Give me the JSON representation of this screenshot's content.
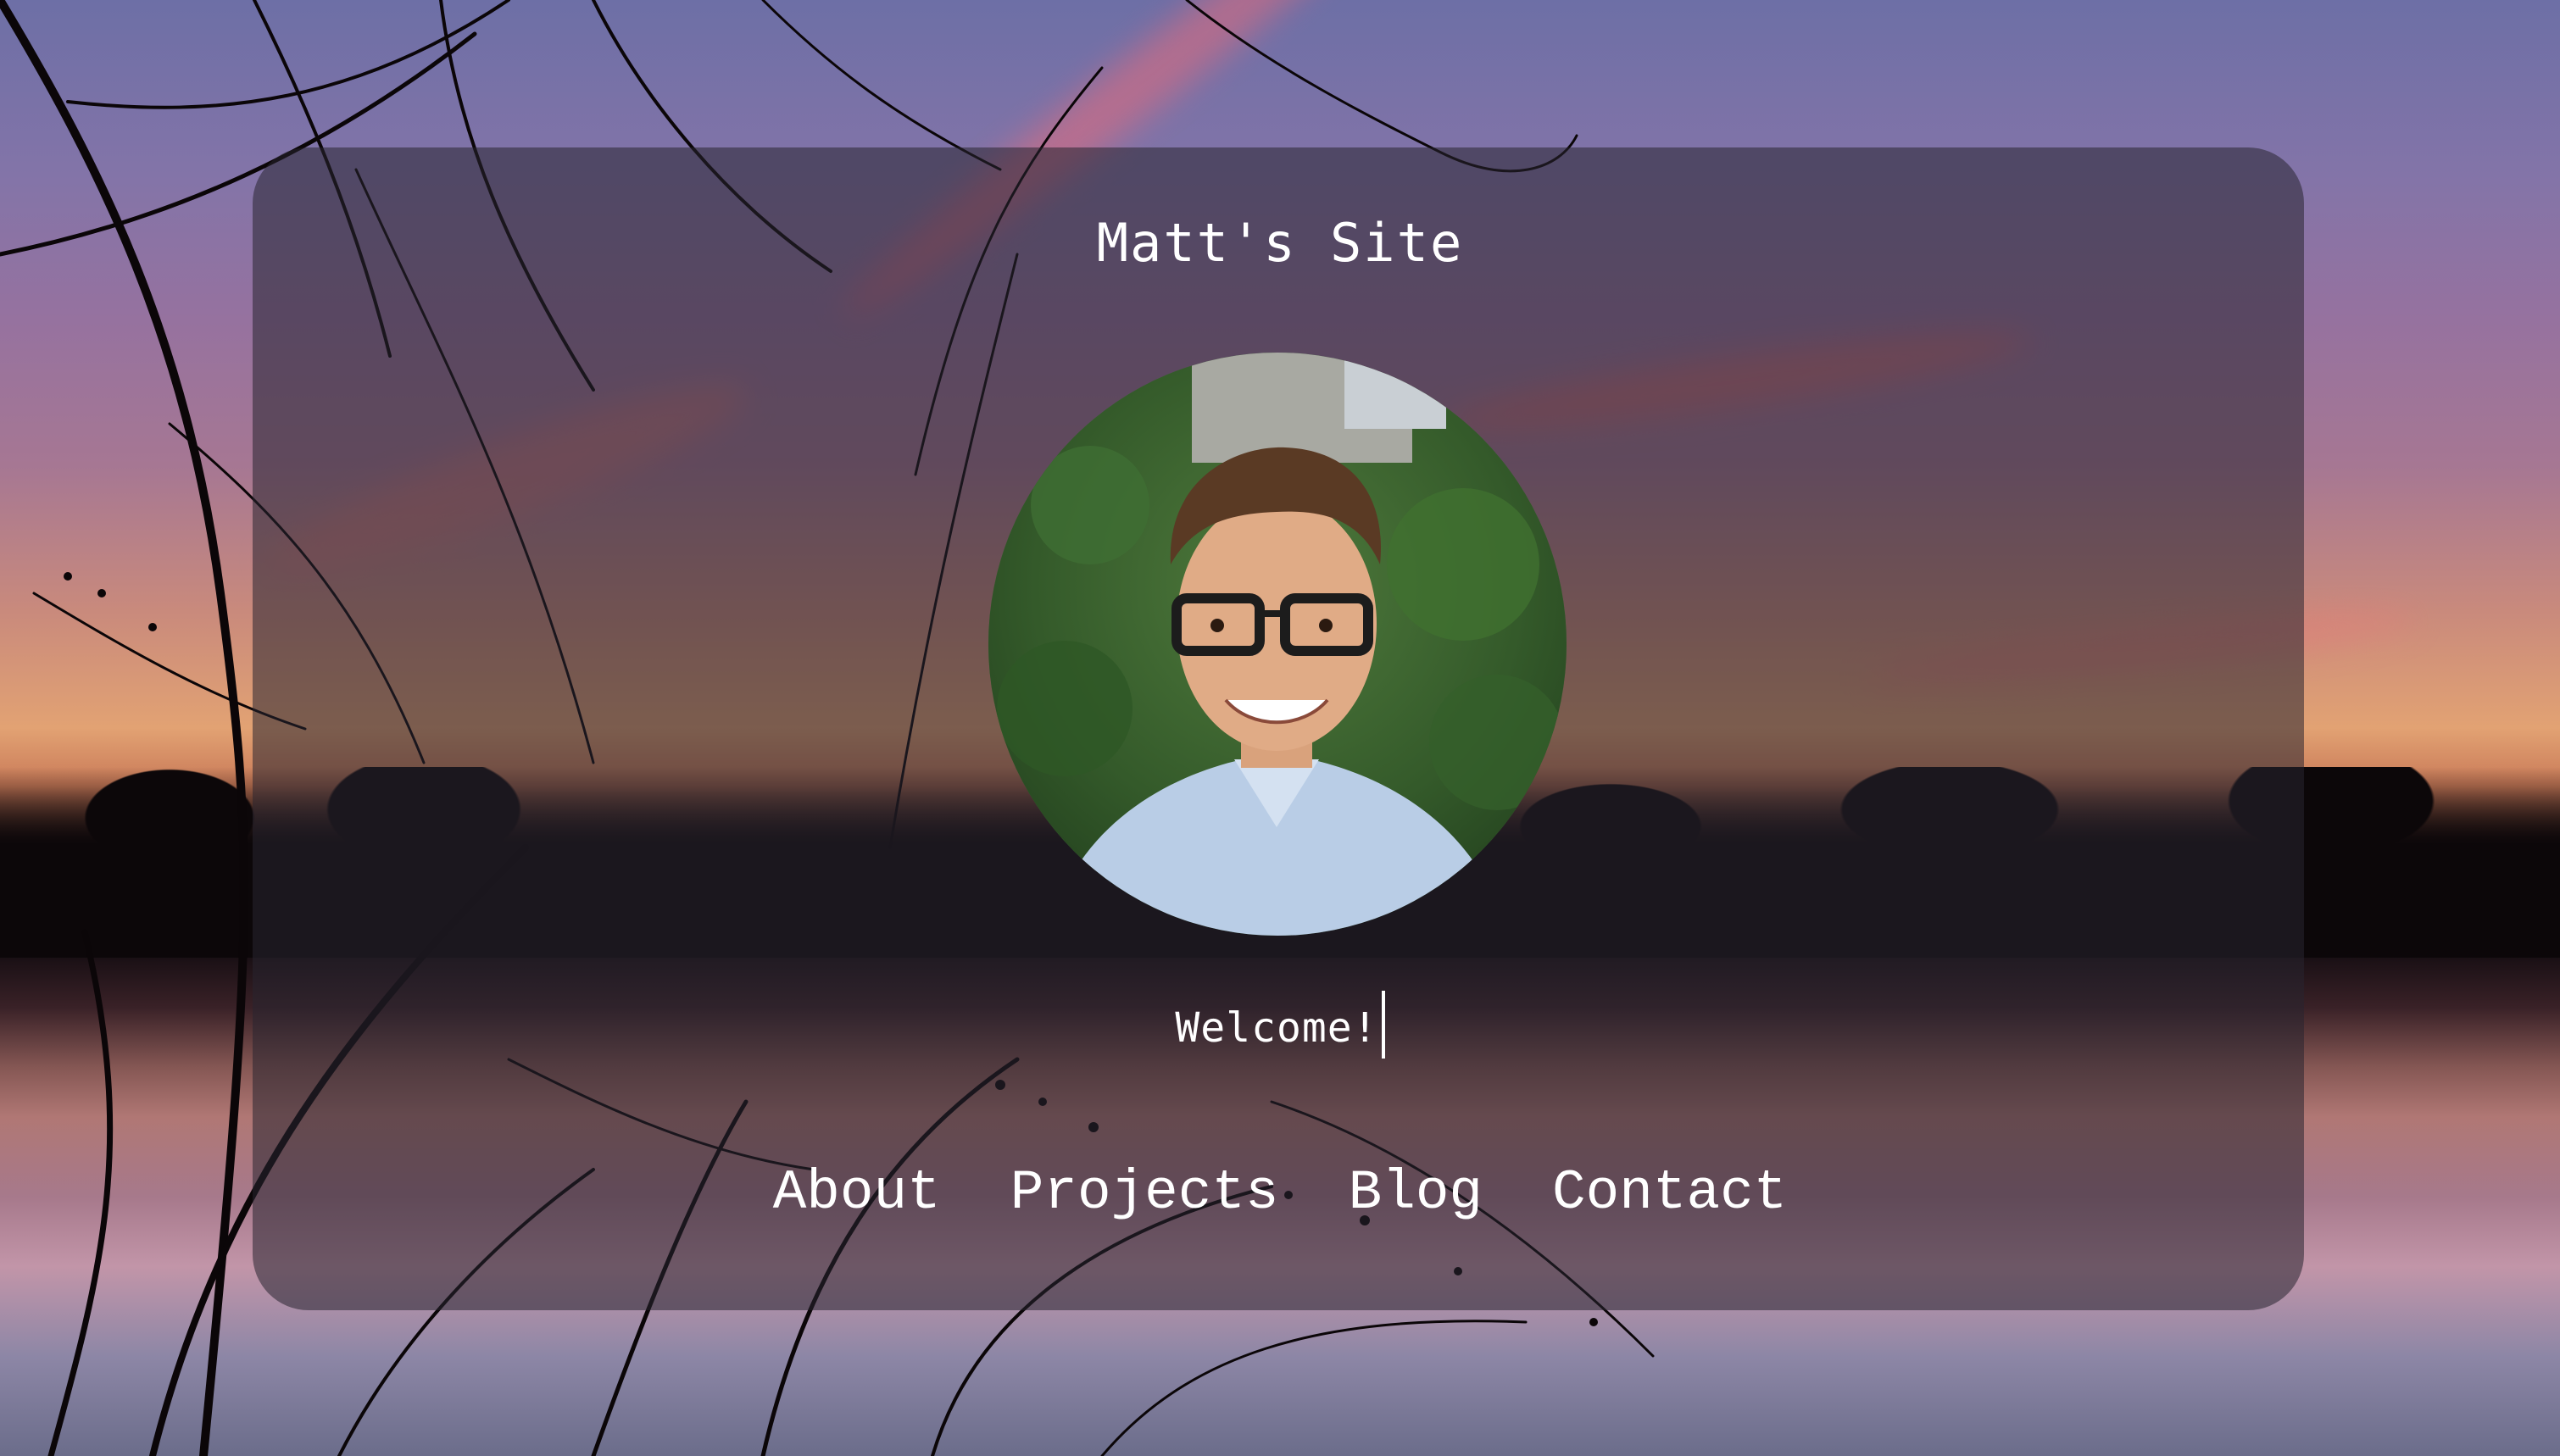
{
  "site": {
    "title": "Matt's Site",
    "welcome_text": "Welcome!"
  },
  "nav": {
    "items": [
      {
        "label": "About"
      },
      {
        "label": "Projects"
      },
      {
        "label": "Blog"
      },
      {
        "label": "Contact"
      }
    ]
  },
  "colors": {
    "text": "#ffffff",
    "card_overlay": "rgba(40,36,48,0.55)"
  }
}
